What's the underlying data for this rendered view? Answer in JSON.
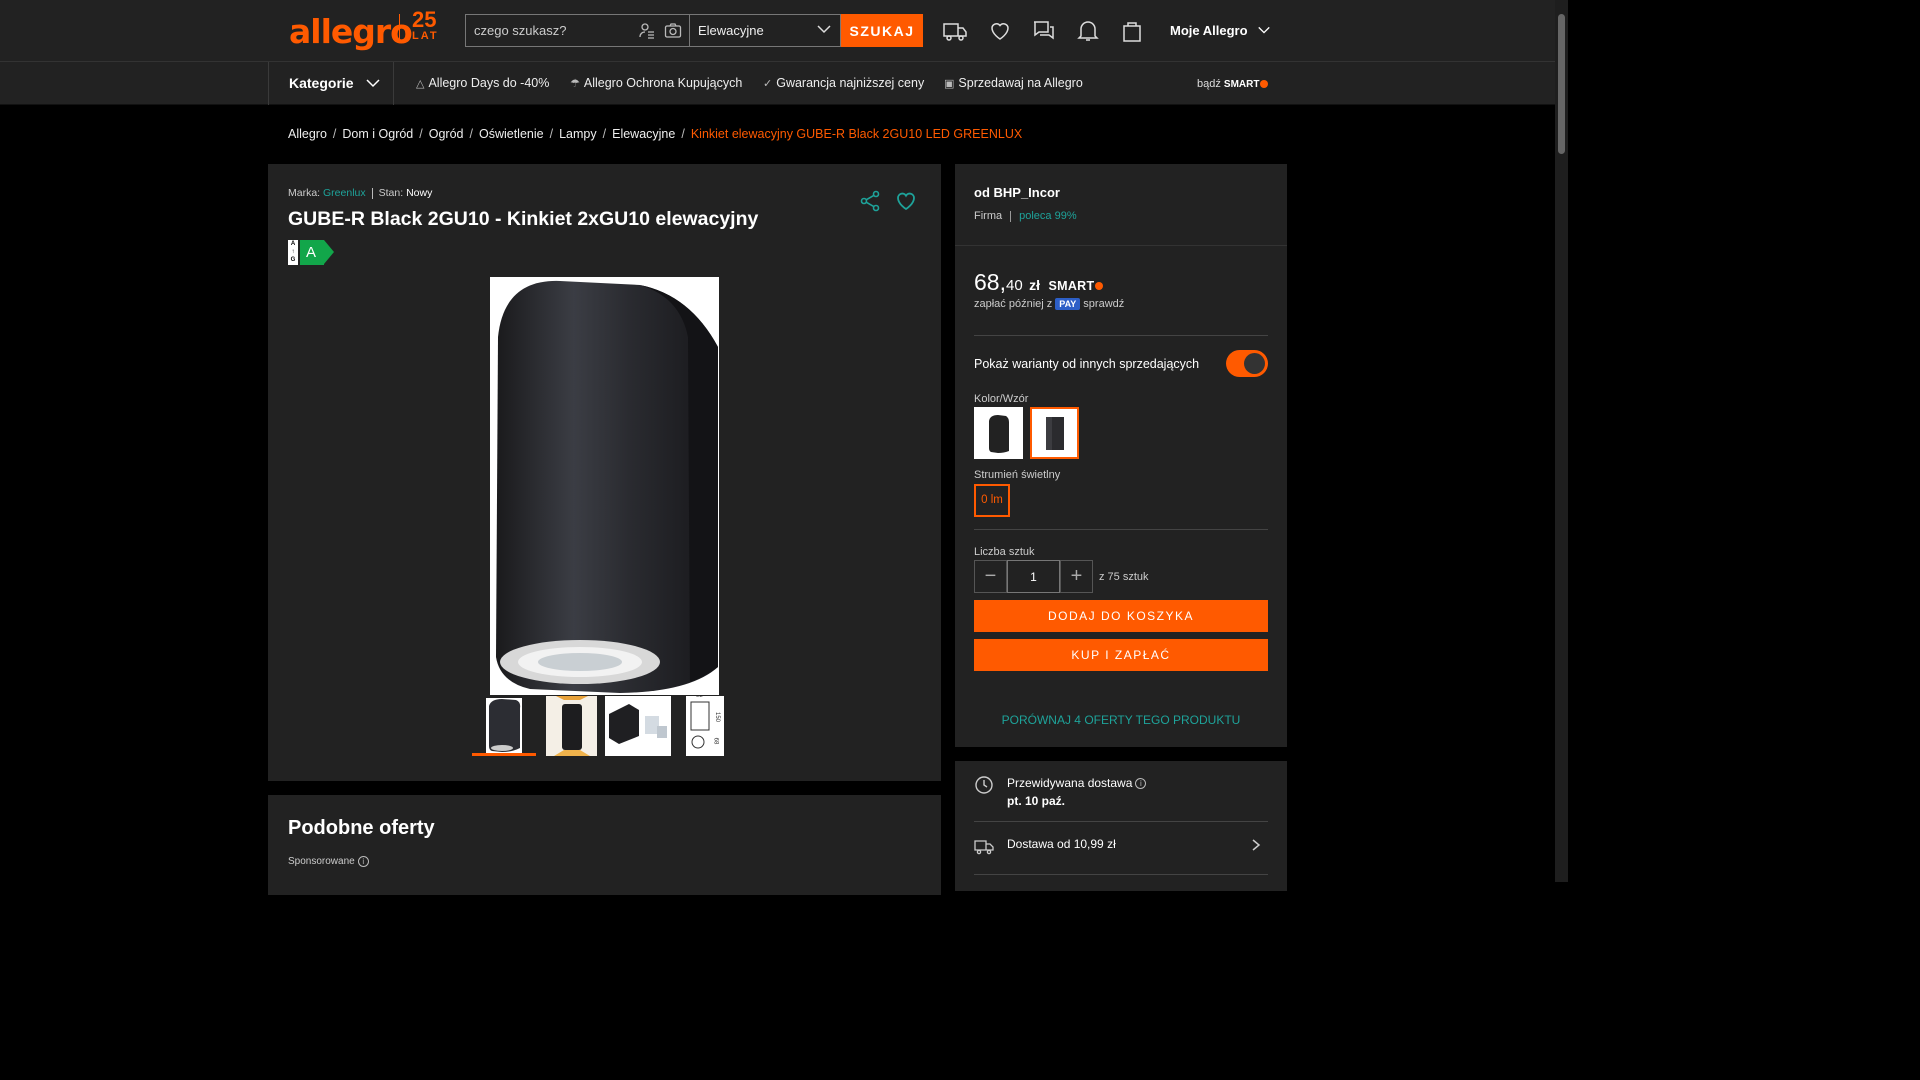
{
  "header": {
    "logo": "allegro",
    "logo_badge_num": "25",
    "logo_badge_txt": "LAT",
    "search_placeholder": "czego szukasz?",
    "category_select": "Elewacyjne",
    "search_button": "SZUKAJ",
    "account_label": "Moje Allegro"
  },
  "nav": {
    "categories": "Kategorie",
    "items": [
      "Allegro Days do -40%",
      "Allegro Ochrona Kupujących",
      "Gwarancja najniższej ceny",
      "Sprzedawaj na Allegro"
    ],
    "smart_prefix": "bądź",
    "smart_label": "SMART"
  },
  "breadcrumb": {
    "items": [
      "Allegro",
      "Dom i Ogród",
      "Ogród",
      "Oświetlenie",
      "Lampy",
      "Elewacyjne"
    ],
    "current": "Kinkiet elewacyjny GUBE-R Black 2GU10 LED GREENLUX"
  },
  "product": {
    "brand_label": "Marka:",
    "brand": "Greenlux",
    "condition_label": "Stan:",
    "condition": "Nowy",
    "title": "GUBE-R Black 2GU10 - Kinkiet 2xGU10 elewacyjny",
    "energy_scale": "A\nG",
    "energy_class": "A",
    "thumb_dims": [
      "92",
      "150",
      "68"
    ]
  },
  "similar": {
    "title": "Podobne oferty",
    "sponsored": "Sponsorowane"
  },
  "offer": {
    "seller": "od BHP_Incor",
    "seller_type": "Firma",
    "recommend": "poleca 99%",
    "price_whole": "68,",
    "price_cents": "40",
    "currency": "zł",
    "smart": "SMART",
    "paylater_prefix": "zapłać później z",
    "pay_badge": "PAY",
    "paylater_suffix": "sprawdź",
    "variants_toggle_label": "Pokaż warianty od innych sprzedających",
    "variants_toggle_on": true,
    "color_label": "Kolor/Wzór",
    "flux_label": "Strumień świetlny",
    "flux_option": "0 lm",
    "qty_label": "Liczba sztuk",
    "qty_value": "1",
    "qty_available": "z 75 sztuk",
    "add_to_cart": "DODAJ DO KOSZYKA",
    "buy_now": "KUP I ZAPŁAĆ",
    "compare": "PORÓWNAJ 4 OFERTY TEGO PRODUKTU"
  },
  "delivery": {
    "title": "Przewidywana dostawa",
    "date": "pt. 10 paź.",
    "cost": "Dostawa od 10,99 zł"
  },
  "colors": {
    "accent": "#ff5a00",
    "teal": "#1ea39a",
    "panel": "#222222",
    "background": "#000000"
  }
}
